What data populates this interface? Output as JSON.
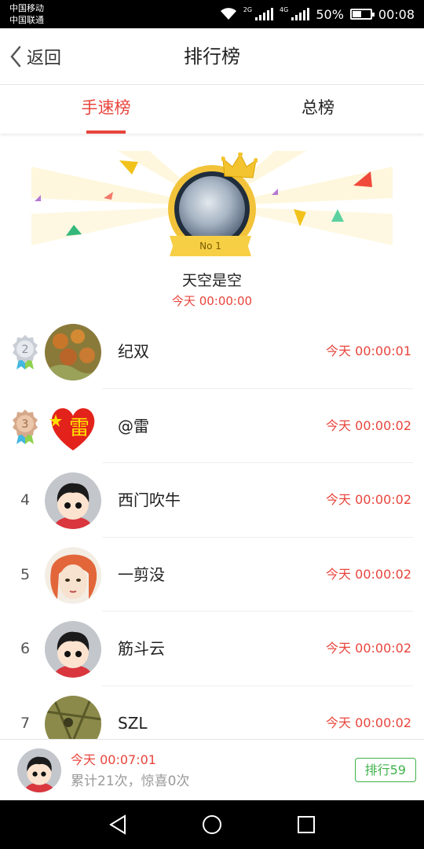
{
  "status_bar": {
    "carrier_1": "中国移动",
    "carrier_2": "中国联通",
    "net_1": "2G",
    "net_2": "4G",
    "battery": "50%",
    "battery_level": 0.5,
    "time": "00:08"
  },
  "header": {
    "back_label": "返回",
    "title": "排行榜"
  },
  "tabs": [
    {
      "label": "手速榜",
      "active": true
    },
    {
      "label": "总榜",
      "active": false
    }
  ],
  "champion": {
    "badge": "No 1",
    "name": "天空是空",
    "time": "今天 00:00:00"
  },
  "rankings": [
    {
      "rank": "2",
      "name": "纪双",
      "time": "今天 00:00:01"
    },
    {
      "rank": "3",
      "name": "@雷",
      "time": "今天 00:00:02"
    },
    {
      "rank": "4",
      "name": "西门吹牛",
      "time": "今天 00:00:02"
    },
    {
      "rank": "5",
      "name": "一剪没",
      "time": "今天 00:00:02"
    },
    {
      "rank": "6",
      "name": "筋斗云",
      "time": "今天 00:00:02"
    },
    {
      "rank": "7",
      "name": "SZL",
      "time": "今天 00:00:02"
    }
  ],
  "avatar_flag_text": "雷",
  "me": {
    "time": "今天 00:07:01",
    "stats": "累计21次，惊喜0次",
    "rank_button": "排行59"
  },
  "colors": {
    "accent": "#e8453c",
    "rank_button": "#3fb24a",
    "medal_gold": "#f2c33a"
  }
}
